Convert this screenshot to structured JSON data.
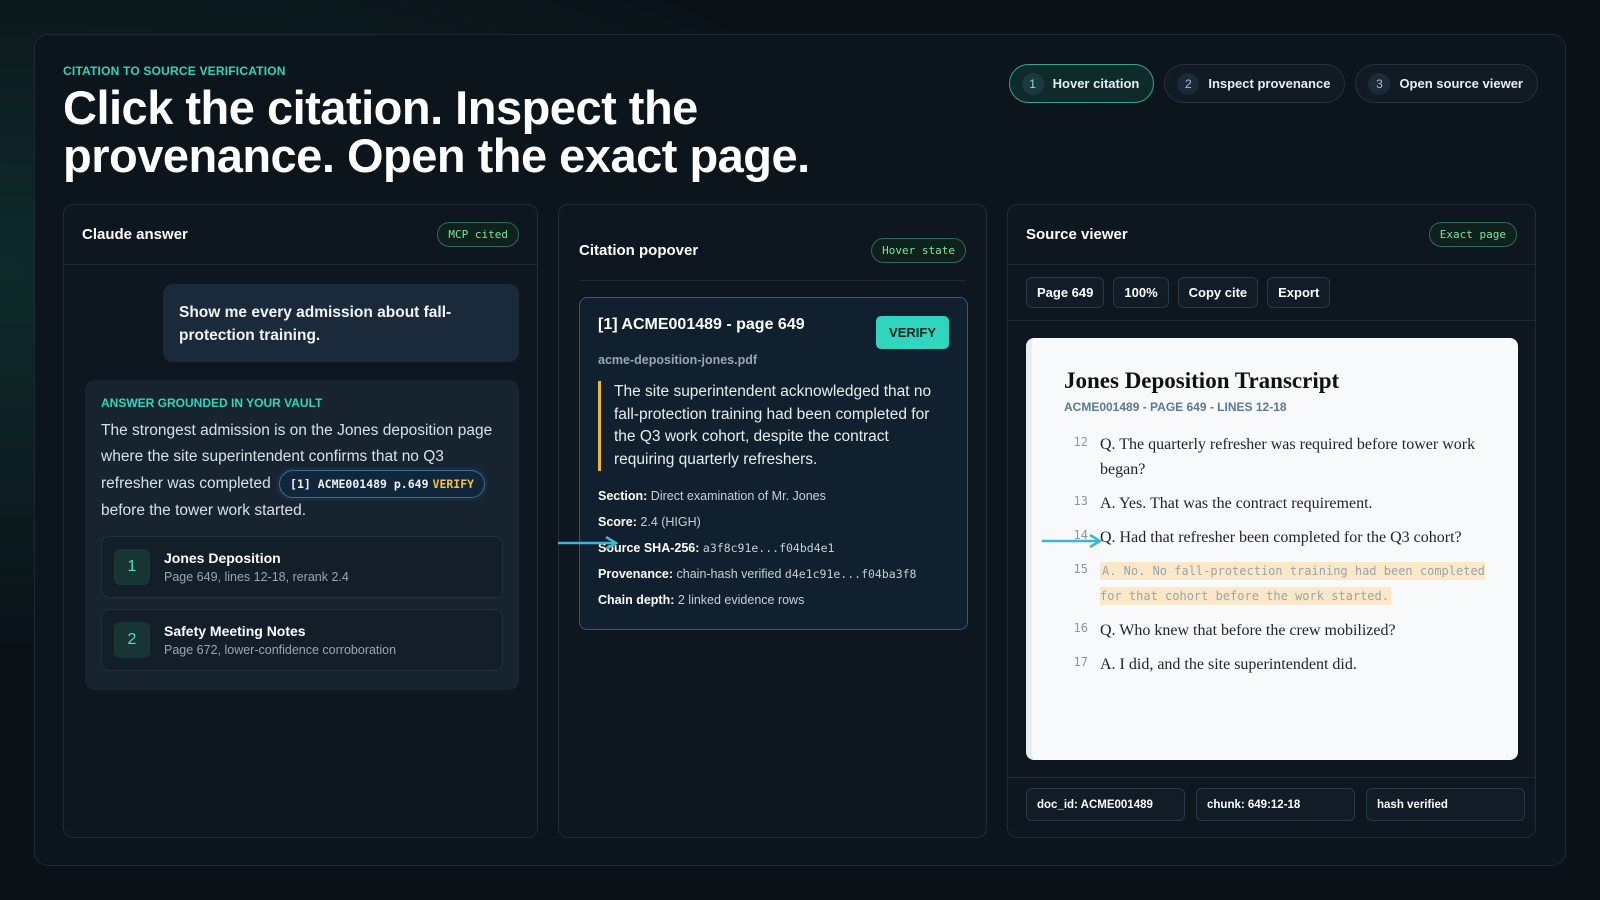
{
  "header": {
    "eyebrow": "CITATION TO SOURCE VERIFICATION",
    "headline_line1": "Click the citation. Inspect the",
    "headline_line2": "provenance. Open the exact page."
  },
  "steps": [
    {
      "num": "1",
      "label": "Hover citation",
      "active": true
    },
    {
      "num": "2",
      "label": "Inspect provenance",
      "active": false
    },
    {
      "num": "3",
      "label": "Open source viewer",
      "active": false
    }
  ],
  "claude_panel": {
    "title": "Claude answer",
    "badge": "MCP cited",
    "user_message": "Show me every admission about fall-protection training.",
    "answer_eyebrow": "ANSWER GROUNDED IN YOUR VAULT",
    "answer_text_before": "The strongest admission is on the Jones deposition page where the site superintendent confirms that no Q3 refresher was completed",
    "citation_label": "[1] ACME001489 p.649",
    "citation_verify": "VERIFY",
    "answer_text_after": "before the tower work started.",
    "sources": [
      {
        "num": "1",
        "title": "Jones Deposition",
        "sub": "Page 649, lines 12-18, rerank 2.4"
      },
      {
        "num": "2",
        "title": "Safety Meeting Notes",
        "sub": "Page 672, lower-confidence corroboration"
      }
    ]
  },
  "popover_panel": {
    "title": "Citation popover",
    "badge": "Hover state",
    "card_title": "[1] ACME001489 - page 649",
    "verify_label": "VERIFY",
    "file": "acme-deposition-jones.pdf",
    "quote": "The site superintendent acknowledged that no fall-protection training had been completed for the Q3 work cohort, despite the contract requiring quarterly refreshers.",
    "meta": {
      "section_label": "Section:",
      "section_value": "Direct examination of Mr. Jones",
      "score_label": "Score:",
      "score_value": "2.4 (HIGH)",
      "sha_label": "Source SHA-256:",
      "sha_value": "a3f8c91e...f04bd4e1",
      "prov_label": "Provenance:",
      "prov_value": "chain-hash verified",
      "prov_hash": "d4e1c91e...f04ba3f8",
      "depth_label": "Chain depth:",
      "depth_value": "2 linked evidence rows"
    }
  },
  "source_panel": {
    "title": "Source viewer",
    "badge": "Exact page",
    "toolbar": {
      "page": "Page 649",
      "zoom": "100%",
      "copy": "Copy cite",
      "export": "Export"
    },
    "doc_title": "Jones Deposition Transcript",
    "doc_sub": "ACME001489 - PAGE 649 - LINES 12-18",
    "lines": [
      {
        "n": "12",
        "t": "Q. The quarterly refresher was required before tower work began?"
      },
      {
        "n": "13",
        "t": "A. Yes. That was the contract requirement."
      },
      {
        "n": "14",
        "t": "Q. Had that refresher been completed for the Q3 cohort?"
      },
      {
        "n": "15",
        "t": "A. No. No fall-protection training had been completed for that cohort before the work started."
      },
      {
        "n": "16",
        "t": "Q. Who knew that before the crew mobilized?"
      },
      {
        "n": "17",
        "t": "A. I did, and the site superintendent did."
      }
    ],
    "footer": {
      "doc_id": "doc_id: ACME001489",
      "chunk": "chunk: 649:12-18",
      "hash": "hash verified"
    }
  },
  "colors": {
    "accent": "#2fd5bd",
    "highlight": "#fbe8c8",
    "verify_badge": "#f3c34a"
  }
}
